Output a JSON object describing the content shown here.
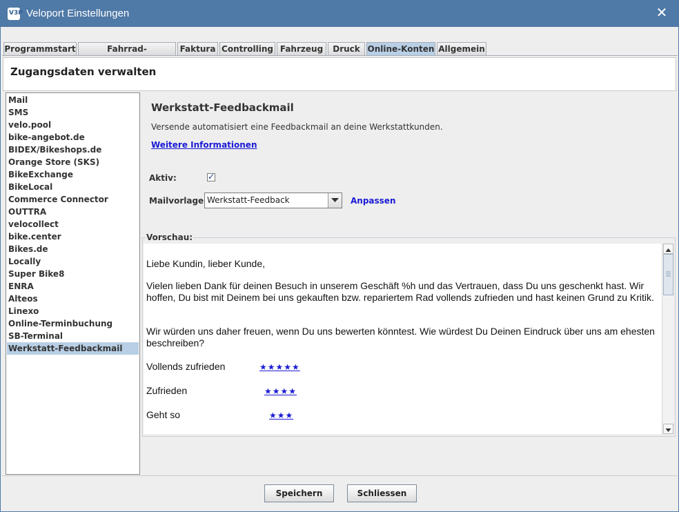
{
  "window": {
    "title": "Veloport Einstellungen",
    "icon_text": "V3P"
  },
  "tabs": [
    {
      "label": "Programmstart"
    },
    {
      "label": "Fahrrad-Konfigurator"
    },
    {
      "label": "Faktura"
    },
    {
      "label": "Controlling"
    },
    {
      "label": "Fahrzeug"
    },
    {
      "label": "Druck"
    },
    {
      "label": "Online-Konten",
      "active": true
    },
    {
      "label": "Allgemein"
    }
  ],
  "header": {
    "title": "Zugangsdaten verwalten"
  },
  "sidebar": {
    "items": [
      {
        "label": "Mail"
      },
      {
        "label": "SMS"
      },
      {
        "label": "velo.pool"
      },
      {
        "label": "bike-angebot.de"
      },
      {
        "label": "BIDEX/Bikeshops.de"
      },
      {
        "label": "Orange Store (SKS)"
      },
      {
        "label": "BikeExchange"
      },
      {
        "label": "BikeLocal"
      },
      {
        "label": "Commerce Connector"
      },
      {
        "label": "OUTTRA"
      },
      {
        "label": "velocollect"
      },
      {
        "label": "bike.center"
      },
      {
        "label": "Bikes.de"
      },
      {
        "label": "Locally"
      },
      {
        "label": "Super Bike8"
      },
      {
        "label": "ENRA"
      },
      {
        "label": "Alteos"
      },
      {
        "label": "Linexo"
      },
      {
        "label": "Online-Terminbuchung"
      },
      {
        "label": "SB-Terminal"
      },
      {
        "label": "Werkstatt-Feedbackmail",
        "selected": true
      }
    ]
  },
  "content": {
    "title": "Werkstatt-Feedbackmail",
    "description": "Versende automatisiert eine Feedbackmail an deine Werkstattkunden.",
    "more_link": "Weitere Informationen",
    "active_label": "Aktiv:",
    "active_checked": true,
    "template_label": "Mailvorlage:",
    "template_value": "Werkstatt-Feedback",
    "adjust_label": "Anpassen"
  },
  "preview": {
    "legend": "Vorschau:",
    "greeting": "Liebe Kundin, lieber Kunde,",
    "para1": "Vielen lieben Dank für deinen Besuch in unserem Geschäft %h und das Vertrauen, dass Du uns geschenkt hast. Wir hoffen, Du bist mit Deinem bei uns gekauften bzw. repariertem Rad vollends zufrieden und hast keinen Grund zu Kritik.",
    "para2": "Wir würden uns daher freuen, wenn Du uns bewerten könntest. Wie würdest Du Deinen Eindruck über uns am ehesten beschreiben?",
    "ratings": [
      {
        "label": "Vollends zufrieden",
        "stars": "★★★★★"
      },
      {
        "label": "Zufrieden",
        "stars": "★★★★"
      },
      {
        "label": "Geht so",
        "stars": "★★★"
      }
    ]
  },
  "footer": {
    "save_label": "Speichern",
    "close_label": "Schliessen"
  },
  "colors": {
    "titlebar": "#4f79a6",
    "selection": "#b8cfe5",
    "link": "#1a1ad6"
  }
}
